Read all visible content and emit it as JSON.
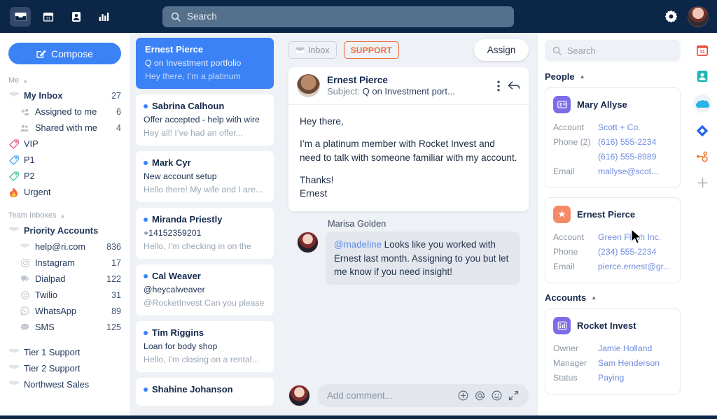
{
  "topbar": {
    "icons": [
      "inbox-icon",
      "calendar-icon",
      "contacts-icon",
      "analytics-icon"
    ],
    "search_placeholder": "Search",
    "settings_icon": "gear-icon",
    "avatar": "user-avatar"
  },
  "sidebar": {
    "compose_label": "Compose",
    "sections": [
      {
        "title": "Me"
      },
      {
        "title": "Team Inboxes"
      }
    ],
    "me_items": [
      {
        "label": "My Inbox",
        "count": "27",
        "icon": "inbox-icon",
        "bold": true
      },
      {
        "label": "Assigned to me",
        "count": "6",
        "icon": "assigned-icon",
        "sub": true
      },
      {
        "label": "Shared with me",
        "count": "4",
        "icon": "shared-icon",
        "sub": true
      },
      {
        "label": "VIP",
        "count": "",
        "icon": "tag-icon",
        "color": "#e8457c"
      },
      {
        "label": "P1",
        "count": "",
        "icon": "tag-icon",
        "color": "#3b9df5"
      },
      {
        "label": "P2",
        "count": "",
        "icon": "tag-icon",
        "color": "#2fc08a"
      },
      {
        "label": "Urgent",
        "count": "",
        "icon": "fire-icon",
        "color": "#f4683b"
      }
    ],
    "team_items": [
      {
        "label": "Priority Accounts",
        "count": "",
        "icon": "inbox-icon",
        "bold": true
      },
      {
        "label": "help@ri.com",
        "count": "836",
        "icon": "inbox-icon",
        "sub": true
      },
      {
        "label": "Instagram",
        "count": "17",
        "icon": "instagram-icon",
        "sub": true
      },
      {
        "label": "Dialpad",
        "count": "122",
        "icon": "dialpad-icon",
        "sub": true
      },
      {
        "label": "Twilio",
        "count": "31",
        "icon": "twilio-icon",
        "sub": true
      },
      {
        "label": "WhatsApp",
        "count": "89",
        "icon": "whatsapp-icon",
        "sub": true
      },
      {
        "label": "SMS",
        "count": "125",
        "icon": "sms-icon",
        "sub": true
      }
    ],
    "other_items": [
      {
        "label": "Tier 1 Support",
        "count": "",
        "icon": "inbox-icon"
      },
      {
        "label": "Tier 2 Support",
        "count": "",
        "icon": "inbox-icon"
      },
      {
        "label": "Northwest Sales",
        "count": "",
        "icon": "inbox-icon"
      }
    ]
  },
  "conversations": [
    {
      "name": "Ernest Pierce",
      "subject": "Q on Investment portfolio",
      "preview": "Hey there, I’m a platinum",
      "selected": true
    },
    {
      "name": "Sabrina Calhoun",
      "subject": "Offer accepted - help with wire",
      "preview": "Hey all! I’ve had an offer...",
      "selected": false
    },
    {
      "name": "Mark Cyr",
      "subject": "New account setup",
      "preview": "Hello there! My wife and I are...",
      "selected": false
    },
    {
      "name": "Miranda Priestly",
      "subject": "+14152359201",
      "preview": "Hello, I’m checking in on the",
      "selected": false
    },
    {
      "name": "Cal Weaver",
      "subject": "@heycalweaver",
      "preview": "@RocketInvest Can you please",
      "selected": false
    },
    {
      "name": "Tim Riggins",
      "subject": "Loan for body shop",
      "preview": "Hello, I’m closing on a rental...",
      "selected": false
    },
    {
      "name": "Shahine Johanson",
      "subject": "",
      "preview": "",
      "selected": false
    }
  ],
  "main": {
    "inbox_chip": "Inbox",
    "support_chip": "SUPPORT",
    "assign_label": "Assign",
    "message": {
      "sender": "Ernest Pierce",
      "subject_prefix": "Subject:",
      "subject": "Q on Investment port...",
      "more_icon": "kebab-menu-icon",
      "reply_icon": "reply-icon",
      "paragraphs": [
        "Hey there,",
        "I’m a platinum member with Rocket Invest and need to talk with someone familiar with my account.",
        "Thanks!\nErnest"
      ]
    },
    "comment": {
      "author": "Marisa Golden",
      "mention": "@madeline",
      "text": " Looks like you worked with Ernest last month. Assigning to you but let me know if you need insight!"
    },
    "composer": {
      "placeholder": "Add comment...",
      "actions": [
        "add-icon",
        "mention-icon",
        "emoji-icon",
        "expand-icon"
      ]
    }
  },
  "rightpanel": {
    "search_placeholder": "Search",
    "people_section": "People",
    "accounts_section": "Accounts",
    "people": [
      {
        "name": "Mary Allyse",
        "icon": "contact-card-icon",
        "icon_bg": "#7c6ce8",
        "fields": [
          {
            "key": "Account",
            "value": "Scott + Co."
          },
          {
            "key": "Phone (2)",
            "value": "(616) 555-2234"
          },
          {
            "key": "",
            "value": "(616) 555-8989"
          },
          {
            "key": "Email",
            "value": "mallyse@scot..."
          }
        ]
      },
      {
        "name": "Ernest Pierce",
        "icon": "star-badge-icon",
        "icon_bg": "#f58a68",
        "fields": [
          {
            "key": "Account",
            "value": "Green Flash Inc."
          },
          {
            "key": "Phone",
            "value": "(234) 555-2234"
          },
          {
            "key": "Email",
            "value": "pierce.ernest@gr..."
          }
        ]
      }
    ],
    "accounts": [
      {
        "name": "Rocket Invest",
        "icon": "building-icon",
        "icon_bg": "#7c6ce8",
        "fields": [
          {
            "key": "Owner",
            "value": "Jamie Holland"
          },
          {
            "key": "Manager",
            "value": "Sam Henderson"
          },
          {
            "key": "Status",
            "value": "Paying"
          }
        ]
      }
    ]
  },
  "rail": {
    "items": [
      {
        "icon": "calendar-icon",
        "color": "#ea4b3c"
      },
      {
        "icon": "contacts-icon",
        "color": "#21b5b5"
      },
      {
        "icon": "salesforce-icon",
        "color": "#2ab3e6"
      },
      {
        "icon": "jira-icon",
        "color": "#2563eb"
      },
      {
        "icon": "hubspot-icon",
        "color": "#f2762e"
      },
      {
        "icon": "add-app-icon",
        "color": "#a8b0ba"
      }
    ]
  },
  "colors": {
    "topbar": "#0b2646",
    "accent": "#3b82f6",
    "support": "#f4683b",
    "panel_bg": "#eef1f5",
    "link": "#6f8ce0"
  }
}
